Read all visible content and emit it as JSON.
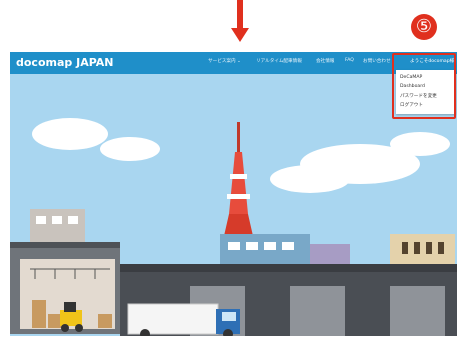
{
  "annotation": {
    "step_number": "⑤"
  },
  "header": {
    "brand": "docomap JAPAN",
    "nav": [
      "サービス案内 ⌄",
      "リアルタイム配車情報",
      "会社情報",
      "FAQ",
      "お問い合わせ"
    ],
    "user_menu": "ようこそdocomap様"
  },
  "dropdown": {
    "items": [
      "DeCaMAP",
      "Dashboard",
      "パスワードを変更",
      "ログアウト"
    ]
  },
  "colors": {
    "header": "#1f8fc9",
    "highlight": "#e0301e",
    "sky": "#a9d6f0"
  }
}
